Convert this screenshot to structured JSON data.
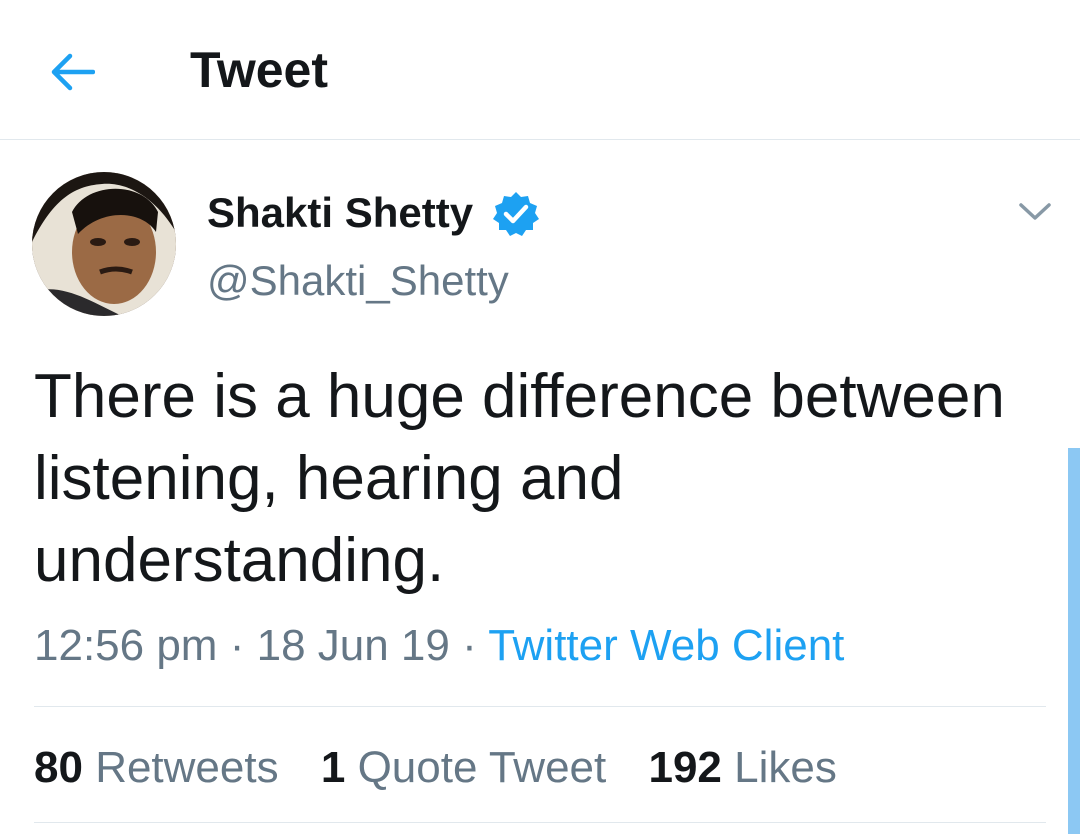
{
  "header": {
    "back_icon": "arrow-left-icon",
    "title": "Tweet"
  },
  "tweet": {
    "author": {
      "display_name": "Shakti Shetty",
      "handle": "@Shakti_Shetty",
      "verified_icon": "verified-badge-icon"
    },
    "menu_icon": "chevron-down-icon",
    "text": "There is a huge difference between listening, hearing and understanding.",
    "time": "12:56 pm",
    "separator": "·",
    "date": "18 Jun 19",
    "source": "Twitter Web Client"
  },
  "stats": {
    "retweets_count": "80",
    "retweets_label": "Retweets",
    "quotes_count": "1",
    "quotes_label": "Quote Tweet",
    "likes_count": "192",
    "likes_label": "Likes"
  },
  "colors": {
    "accent": "#1da1f2",
    "text_primary": "#14171a",
    "text_secondary": "#657786",
    "divider": "#e1e8ed"
  }
}
